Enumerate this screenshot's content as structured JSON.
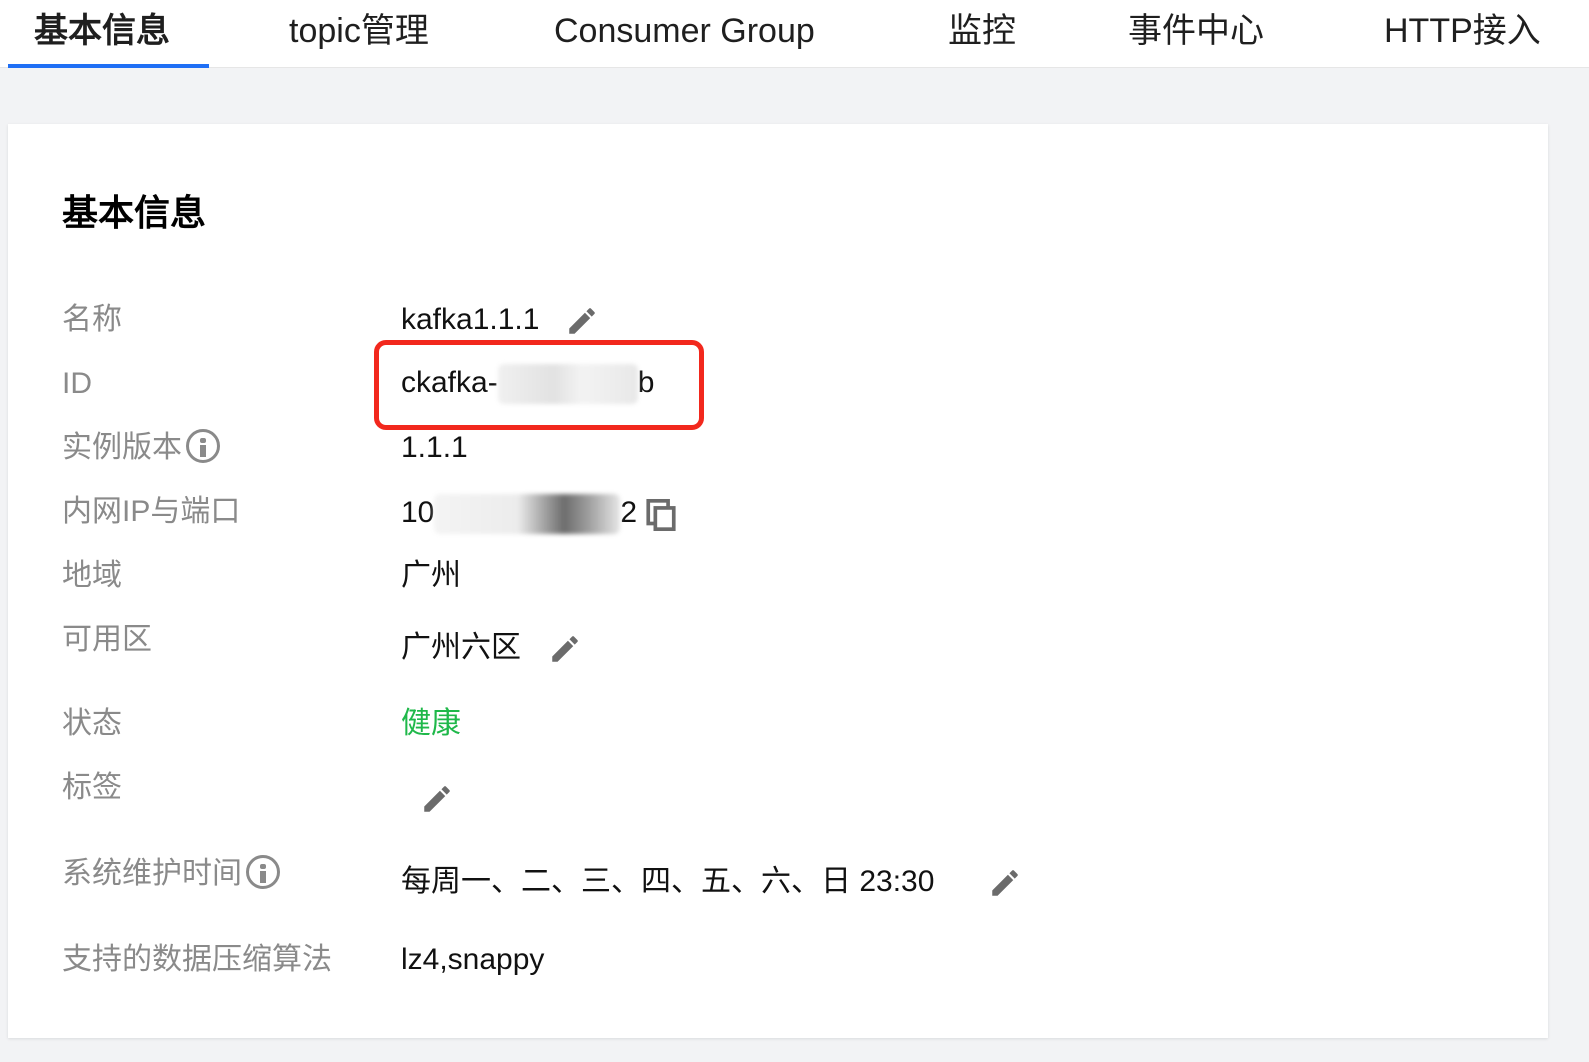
{
  "tabs": [
    {
      "label": "基本信息",
      "active": true
    },
    {
      "label": "topic管理"
    },
    {
      "label": "Consumer Group"
    },
    {
      "label": "监控"
    },
    {
      "label": "事件中心"
    },
    {
      "label": "HTTP接入"
    }
  ],
  "card": {
    "title": "基本信息",
    "fields": {
      "name": {
        "label": "名称",
        "value": "kafka1.1.1"
      },
      "id": {
        "label": "ID",
        "prefix": "ckafka-",
        "suffix": "b"
      },
      "version": {
        "label": "实例版本",
        "value": "1.1.1"
      },
      "ip_port": {
        "label": "内网IP与端口",
        "prefix": "10",
        "suffix": "2"
      },
      "region": {
        "label": "地域",
        "value": "广州"
      },
      "zone": {
        "label": "可用区",
        "value": "广州六区"
      },
      "status": {
        "label": "状态",
        "value": "健康",
        "color": "#1fb84a"
      },
      "tags": {
        "label": "标签",
        "value": ""
      },
      "maintenance": {
        "label": "系统维护时间",
        "value": "每周一、二、三、四、五、六、日 23:30"
      },
      "compression": {
        "label": "支持的数据压缩算法",
        "value": "lz4,snappy"
      }
    }
  },
  "icons": {
    "edit": "pencil-icon",
    "info": "info-icon",
    "copy": "copy-icon"
  },
  "highlight_color": "#f2281d",
  "accent_color": "#1f6ff5"
}
